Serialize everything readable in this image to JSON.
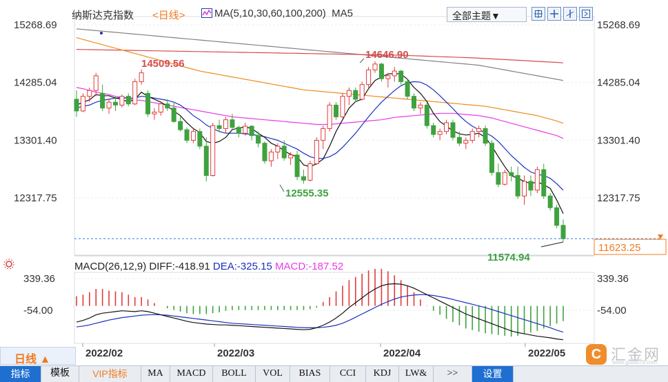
{
  "header": {
    "index_name": "纳斯达克指数",
    "period_label": "<日线>",
    "ma_label": "MA(5,10,30,60,100,200)",
    "ma5_label": "MA5",
    "theme_select": "全部主题▼"
  },
  "price_axis": {
    "ticks": [
      "15268.69",
      "14285.04",
      "13301.40",
      "12317.75"
    ],
    "current_price": "11623.25"
  },
  "annotations": {
    "high_left": "14509.56",
    "high_mid": "14646.90",
    "low_mid": "12555.35",
    "low_last": "11574.94"
  },
  "macd": {
    "params": "MACD(26,12,9)",
    "diff": "DIFF:-418.91",
    "dea": "DEA:-325.15",
    "macd": "MACD:-187.52",
    "ticks": [
      "339.36",
      "-54.00"
    ]
  },
  "time_axis": [
    "2022/02",
    "2022/03",
    "2022/04",
    "2022/05"
  ],
  "period_button": "日线 ▲",
  "bottom_tabs": [
    "指标",
    "模板",
    "VIP指标",
    "MA",
    "MACD",
    "BOLL",
    "VOL",
    "BIAS",
    "CCI",
    "KDJ",
    "LW&",
    ">>",
    "设置"
  ],
  "logo": {
    "text": "汇金网",
    "sub": "www.gold678.com"
  },
  "colors": {
    "up": "#e03a3a",
    "down": "#3ea23e",
    "ma5": "#111111",
    "ma10": "#1a2fbf",
    "ma30": "#e83ae8",
    "ma60": "#f08a1c",
    "ma100": "#d44c4c",
    "ma200": "#808080",
    "accent": "#f47a20",
    "current_line": "#2a7de1"
  },
  "chart_data": {
    "type": "candlestick",
    "price_ticks": [
      15268.69,
      14285.04,
      13301.4,
      12317.75
    ],
    "current": 11623.25,
    "candles": [
      [
        14000,
        14150,
        13700,
        13800
      ],
      [
        13800,
        14100,
        13780,
        14050
      ],
      [
        14050,
        14200,
        13950,
        14150
      ],
      [
        14150,
        14450,
        14050,
        14400
      ],
      [
        14100,
        14250,
        13800,
        13850
      ],
      [
        13850,
        14000,
        13750,
        13950
      ],
      [
        13950,
        14050,
        13800,
        13900
      ],
      [
        13900,
        14080,
        13860,
        14050
      ],
      [
        14050,
        14100,
        13880,
        13920
      ],
      [
        13920,
        14350,
        13900,
        14300
      ],
      [
        14300,
        14509,
        14250,
        14450
      ],
      [
        14100,
        14150,
        13700,
        13750
      ],
      [
        13750,
        13850,
        13650,
        13780
      ],
      [
        13780,
        13950,
        13720,
        13920
      ],
      [
        13920,
        14000,
        13800,
        13850
      ],
      [
        13850,
        13950,
        13600,
        13620
      ],
      [
        13620,
        13700,
        13450,
        13480
      ],
      [
        13480,
        13520,
        13250,
        13300
      ],
      [
        13300,
        13500,
        13250,
        13450
      ],
      [
        13450,
        13500,
        13150,
        13200
      ],
      [
        13200,
        13350,
        12600,
        12700
      ],
      [
        12700,
        13600,
        12680,
        13550
      ],
      [
        13550,
        13650,
        13450,
        13500
      ],
      [
        13500,
        13700,
        13420,
        13650
      ],
      [
        13650,
        13750,
        13480,
        13520
      ],
      [
        13520,
        13550,
        13350,
        13420
      ],
      [
        13420,
        13600,
        13380,
        13540
      ],
      [
        13540,
        13560,
        13300,
        13380
      ],
      [
        13380,
        13450,
        13180,
        13250
      ],
      [
        13250,
        13280,
        12900,
        12950
      ],
      [
        12950,
        13150,
        12850,
        13100
      ],
      [
        13100,
        13250,
        12980,
        13200
      ],
      [
        13200,
        13300,
        12950,
        13000
      ],
      [
        13000,
        13100,
        12880,
        13050
      ],
      [
        13050,
        13120,
        12620,
        12680
      ],
      [
        12680,
        12800,
        12560,
        12620
      ],
      [
        12620,
        12950,
        12600,
        12900
      ],
      [
        12900,
        13350,
        12880,
        13300
      ],
      [
        13300,
        13550,
        13150,
        13500
      ],
      [
        13500,
        13950,
        13450,
        13900
      ],
      [
        13900,
        13950,
        13650,
        13700
      ],
      [
        13700,
        14100,
        13680,
        14050
      ],
      [
        14050,
        14200,
        13900,
        14150
      ],
      [
        14150,
        14200,
        13950,
        14000
      ],
      [
        14000,
        14300,
        13980,
        14250
      ],
      [
        14250,
        14550,
        14200,
        14500
      ],
      [
        14500,
        14646,
        14450,
        14600
      ],
      [
        14600,
        14620,
        14300,
        14350
      ],
      [
        14350,
        14450,
        14200,
        14400
      ],
      [
        14400,
        14550,
        14300,
        14480
      ],
      [
        14480,
        14500,
        14250,
        14300
      ],
      [
        14300,
        14350,
        14000,
        14050
      ],
      [
        14050,
        14100,
        13800,
        13850
      ],
      [
        13850,
        13950,
        13750,
        13900
      ],
      [
        13900,
        13950,
        13500,
        13550
      ],
      [
        13550,
        13600,
        13350,
        13400
      ],
      [
        13400,
        13500,
        13300,
        13450
      ],
      [
        13450,
        13650,
        13400,
        13600
      ],
      [
        13600,
        13650,
        13300,
        13350
      ],
      [
        13350,
        13450,
        13200,
        13250
      ],
      [
        13250,
        13350,
        13150,
        13300
      ],
      [
        13300,
        13500,
        13250,
        13450
      ],
      [
        13450,
        13550,
        13350,
        13500
      ],
      [
        13500,
        13550,
        13200,
        13250
      ],
      [
        13250,
        13300,
        12700,
        12750
      ],
      [
        12750,
        12900,
        12500,
        12550
      ],
      [
        12550,
        12800,
        12530,
        12750
      ],
      [
        12750,
        12850,
        12600,
        12700
      ],
      [
        12700,
        12850,
        12300,
        12350
      ],
      [
        12350,
        12700,
        12200,
        12600
      ],
      [
        12600,
        12700,
        12350,
        12450
      ],
      [
        12450,
        12850,
        12400,
        12800
      ],
      [
        12800,
        12900,
        12300,
        12350
      ],
      [
        12350,
        12400,
        12100,
        12150
      ],
      [
        12150,
        12200,
        11800,
        11850
      ],
      [
        11850,
        11950,
        11574,
        11623
      ]
    ],
    "ma5": [
      13900,
      13950,
      13990,
      14080,
      14060,
      14060,
      14020,
      14000,
      13950,
      14000,
      14120,
      14050,
      14000,
      13950,
      13880,
      13800,
      13720,
      13600,
      13500,
      13430,
      13280,
      13250,
      13280,
      13350,
      13480,
      13510,
      13530,
      13500,
      13420,
      13350,
      13250,
      13200,
      13120,
      13060,
      13020,
      12880,
      12850,
      12900,
      12980,
      13200,
      13450,
      13650,
      13850,
      13960,
      14000,
      14180,
      14320,
      14380,
      14430,
      14440,
      14430,
      14340,
      14200,
      14100,
      13960,
      13760,
      13620,
      13540,
      13460,
      13410,
      13390,
      13400,
      13420,
      13350,
      13200,
      13020,
      12850,
      12700,
      12650,
      12600,
      12560,
      12590,
      12540,
      12480,
      12280,
      12050
    ],
    "ma10": [
      13850,
      13880,
      13900,
      13950,
      13980,
      14000,
      14020,
      14030,
      14020,
      14020,
      14050,
      14040,
      14020,
      14000,
      13980,
      13950,
      13900,
      13820,
      13720,
      13650,
      13560,
      13500,
      13450,
      13420,
      13420,
      13420,
      13410,
      13400,
      13380,
      13360,
      13330,
      13300,
      13250,
      13200,
      13150,
      13080,
      13020,
      12990,
      12990,
      13020,
      13080,
      13180,
      13300,
      13420,
      13560,
      13700,
      13830,
      13950,
      14050,
      14150,
      14230,
      14280,
      14300,
      14290,
      14240,
      14160,
      14060,
      13950,
      13840,
      13720,
      13620,
      13540,
      13480,
      13430,
      13370,
      13280,
      13160,
      13040,
      12940,
      12840,
      12760,
      12720,
      12700,
      12650,
      12560,
      12450
    ],
    "ma30": [
      14200,
      14180,
      14150,
      14120,
      14100,
      14080,
      14050,
      14030,
      14010,
      13990,
      13980,
      13960,
      13940,
      13920,
      13900,
      13880,
      13860,
      13840,
      13820,
      13800,
      13780,
      13760,
      13740,
      13720,
      13700,
      13690,
      13680,
      13670,
      13660,
      13650,
      13640,
      13630,
      13620,
      13610,
      13600,
      13590,
      13580,
      13570,
      13570,
      13570,
      13580,
      13590,
      13600,
      13610,
      13620,
      13630,
      13640,
      13650,
      13670,
      13690,
      13700,
      13710,
      13720,
      13730,
      13740,
      13750,
      13760,
      13760,
      13760,
      13750,
      13740,
      13730,
      13720,
      13700,
      13680,
      13650,
      13620,
      13590,
      13560,
      13530,
      13500,
      13470,
      13440,
      13410,
      13380,
      13330
    ],
    "ma60": [
      15050,
      15020,
      14990,
      14960,
      14930,
      14900,
      14870,
      14840,
      14810,
      14780,
      14750,
      14720,
      14690,
      14660,
      14630,
      14600,
      14570,
      14540,
      14510,
      14480,
      14460,
      14440,
      14420,
      14400,
      14380,
      14360,
      14340,
      14320,
      14300,
      14280,
      14260,
      14240,
      14220,
      14200,
      14180,
      14160,
      14150,
      14140,
      14130,
      14120,
      14110,
      14100,
      14090,
      14080,
      14070,
      14060,
      14050,
      14040,
      14030,
      14020,
      14010,
      14000,
      13990,
      13980,
      13970,
      13960,
      13950,
      13940,
      13930,
      13920,
      13910,
      13900,
      13890,
      13880,
      13860,
      13840,
      13820,
      13800,
      13780,
      13760,
      13740,
      13720,
      13690,
      13660,
      13630,
      13590
    ],
    "ma100": [
      14850,
      14848,
      14846,
      14844,
      14842,
      14840,
      14838,
      14836,
      14834,
      14832,
      14830,
      14828,
      14826,
      14824,
      14822,
      14820,
      14818,
      14816,
      14814,
      14812,
      14810,
      14808,
      14806,
      14804,
      14802,
      14800,
      14798,
      14796,
      14794,
      14792,
      14790,
      14788,
      14786,
      14784,
      14782,
      14780,
      14778,
      14776,
      14774,
      14772,
      14770,
      14768,
      14766,
      14764,
      14762,
      14760,
      14758,
      14756,
      14754,
      14752,
      14750,
      14746,
      14742,
      14738,
      14734,
      14730,
      14726,
      14722,
      14718,
      14714,
      14710,
      14706,
      14700,
      14694,
      14688,
      14682,
      14676,
      14670,
      14664,
      14658,
      14652,
      14646,
      14640,
      14634,
      14628,
      14620
    ],
    "ma200": [
      15200,
      15190,
      15180,
      15170,
      15160,
      15150,
      15140,
      15130,
      15120,
      15110,
      15100,
      15090,
      15080,
      15070,
      15060,
      15050,
      15040,
      15030,
      15020,
      15010,
      15000,
      14990,
      14980,
      14970,
      14960,
      14950,
      14940,
      14930,
      14920,
      14910,
      14900,
      14890,
      14880,
      14870,
      14860,
      14850,
      14840,
      14830,
      14820,
      14810,
      14800,
      14790,
      14780,
      14770,
      14760,
      14750,
      14740,
      14730,
      14720,
      14710,
      14700,
      14690,
      14680,
      14670,
      14660,
      14650,
      14640,
      14630,
      14620,
      14610,
      14600,
      14590,
      14580,
      14560,
      14540,
      14520,
      14500,
      14480,
      14460,
      14440,
      14420,
      14400,
      14380,
      14360,
      14340,
      14320
    ],
    "macd_axis": [
      339.36,
      -54.0
    ],
    "macd_diff": [
      -200,
      -180,
      -150,
      -110,
      -90,
      -80,
      -70,
      -60,
      -65,
      -70,
      -60,
      -70,
      -90,
      -110,
      -130,
      -150,
      -170,
      -190,
      -205,
      -215,
      -225,
      -230,
      -235,
      -235,
      -240,
      -245,
      -250,
      -255,
      -260,
      -265,
      -270,
      -275,
      -280,
      -285,
      -290,
      -295,
      -290,
      -270,
      -240,
      -200,
      -150,
      -90,
      -20,
      40,
      100,
      160,
      210,
      250,
      270,
      275,
      270,
      250,
      220,
      180,
      140,
      100,
      60,
      20,
      -20,
      -60,
      -100,
      -130,
      -160,
      -190,
      -220,
      -250,
      -280,
      -310,
      -330,
      -345,
      -360,
      -375,
      -385,
      -395,
      -410,
      -419
    ],
    "macd_dea": [
      -260,
      -250,
      -235,
      -215,
      -195,
      -175,
      -160,
      -145,
      -135,
      -125,
      -115,
      -110,
      -108,
      -110,
      -115,
      -125,
      -135,
      -145,
      -155,
      -165,
      -175,
      -185,
      -195,
      -205,
      -215,
      -220,
      -225,
      -230,
      -235,
      -240,
      -245,
      -250,
      -255,
      -260,
      -265,
      -270,
      -270,
      -270,
      -265,
      -255,
      -240,
      -215,
      -180,
      -140,
      -100,
      -60,
      -20,
      20,
      55,
      85,
      110,
      125,
      135,
      140,
      138,
      130,
      115,
      100,
      80,
      60,
      40,
      20,
      0,
      -20,
      -45,
      -70,
      -95,
      -120,
      -145,
      -170,
      -195,
      -220,
      -245,
      -270,
      -300,
      -325
    ],
    "macd_hist": [
      120,
      140,
      170,
      210,
      210,
      190,
      180,
      170,
      140,
      110,
      110,
      80,
      36,
      0,
      -30,
      -50,
      -70,
      -90,
      -100,
      -100,
      -100,
      -90,
      -80,
      -60,
      -50,
      -50,
      -50,
      -50,
      -50,
      -50,
      -50,
      -50,
      -50,
      -50,
      -50,
      -50,
      -40,
      -20,
      50,
      110,
      180,
      250,
      320,
      360,
      400,
      440,
      460,
      460,
      430,
      380,
      320,
      250,
      170,
      80,
      4,
      -60,
      -110,
      -160,
      -200,
      -240,
      -280,
      -300,
      -320,
      -340,
      -350,
      -360,
      -370,
      -380,
      -370,
      -350,
      -330,
      -310,
      -280,
      -250,
      -220,
      -188
    ]
  }
}
